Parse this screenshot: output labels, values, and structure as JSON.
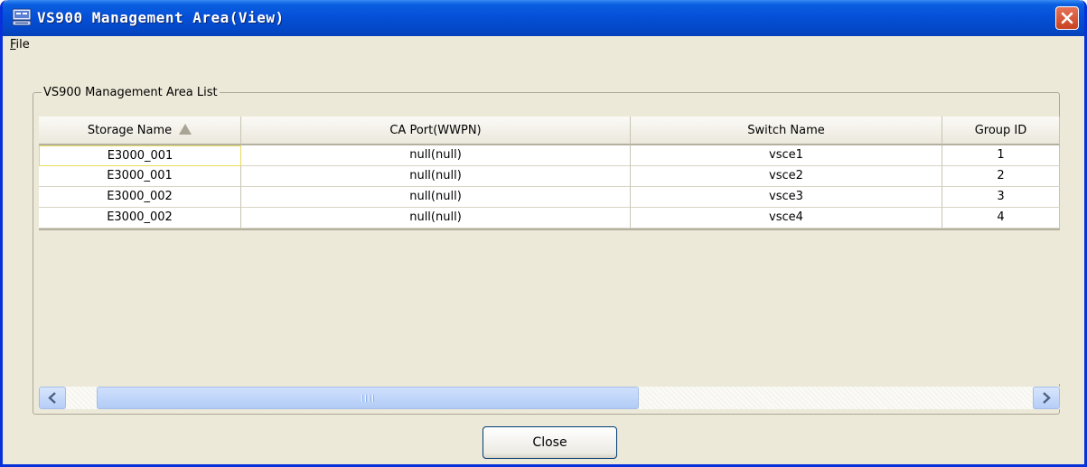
{
  "window": {
    "title": "VS900 Management Area(View)"
  },
  "menu": {
    "file_mnemonic": "F",
    "file_rest": "ile"
  },
  "group": {
    "label": "VS900 Management Area List"
  },
  "table": {
    "columns": [
      "Storage Name",
      "CA Port(WWPN)",
      "Switch Name",
      "Group ID"
    ],
    "sorted_column": "Storage Name",
    "sort_direction": "ascending",
    "rows": [
      [
        "E3000_001",
        "null(null)",
        "vsce1",
        "1"
      ],
      [
        "E3000_001",
        "null(null)",
        "vsce2",
        "2"
      ],
      [
        "E3000_002",
        "null(null)",
        "vsce3",
        "3"
      ],
      [
        "E3000_002",
        "null(null)",
        "vsce4",
        "4"
      ]
    ]
  },
  "buttons": {
    "close": "Close"
  },
  "icons": {
    "app": "storage-manager-icon",
    "window_close": "close-x-icon",
    "sort": "sort-ascending-icon",
    "scroll_left": "chevron-left-icon",
    "scroll_right": "chevron-right-icon"
  },
  "colors": {
    "titlebar": "#0550D8",
    "window_bg": "#ECE9D8",
    "close_button": "#D7502D",
    "scrollbar_thumb": "#B6CCF7",
    "selected_cell_border": "#E8D95C"
  }
}
